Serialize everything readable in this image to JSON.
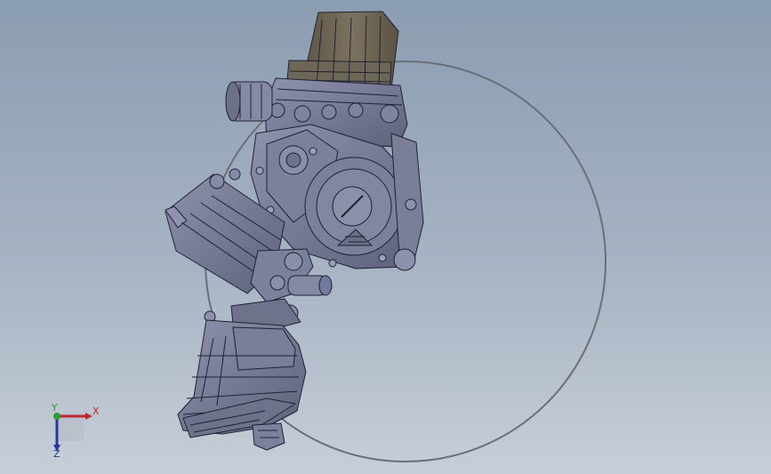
{
  "viewport": {
    "background_top": "#8b9db2",
    "background_bottom": "#c7ced8"
  },
  "model": {
    "part_color": "#767a96",
    "edge_color": "#1f2233",
    "dark_part_color": "#6b6252",
    "circle_color": "#6b6f77"
  },
  "triad": {
    "x_label": "X",
    "y_label": "Y",
    "z_label": "Z",
    "x_color": "#c0262e",
    "y_color": "#2e9c34",
    "z_color": "#243a9c"
  }
}
